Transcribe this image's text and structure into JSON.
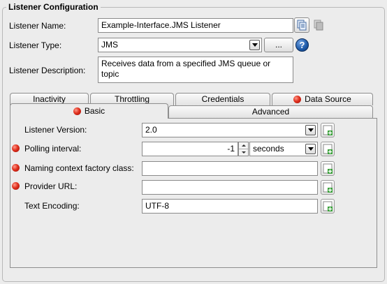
{
  "group": {
    "title": "Listener Configuration"
  },
  "listener": {
    "name_label": "Listener Name:",
    "name_value": "Example-Interface.JMS Listener",
    "type_label": "Listener Type:",
    "type_value": "JMS",
    "browse_label": "...",
    "help_glyph": "?",
    "description_label": "Listener Description:",
    "description_value": "Receives data from a specified JMS queue or topic"
  },
  "tabs": {
    "row1": [
      "Inactivity",
      "Throttling",
      "Credentials",
      "Data Source"
    ],
    "row2": [
      "Basic",
      "Advanced"
    ],
    "active": "Basic"
  },
  "basic": {
    "version_label": "Listener Version:",
    "version_value": "2.0",
    "polling_label": "Polling interval:",
    "polling_value": "-1",
    "polling_unit": "seconds",
    "naming_label": "Naming context factory class:",
    "naming_value": "",
    "provider_label": "Provider URL:",
    "provider_value": "",
    "encoding_label": "Text Encoding:",
    "encoding_value": "UTF-8"
  },
  "colors": {
    "required": "#e0301e",
    "help": "#1e5aa8",
    "add": "#3aa03a"
  },
  "icons": [
    "copy-icon",
    "paste-icon",
    "help-icon",
    "required-icon",
    "add-icon",
    "chevron-down-icon"
  ]
}
